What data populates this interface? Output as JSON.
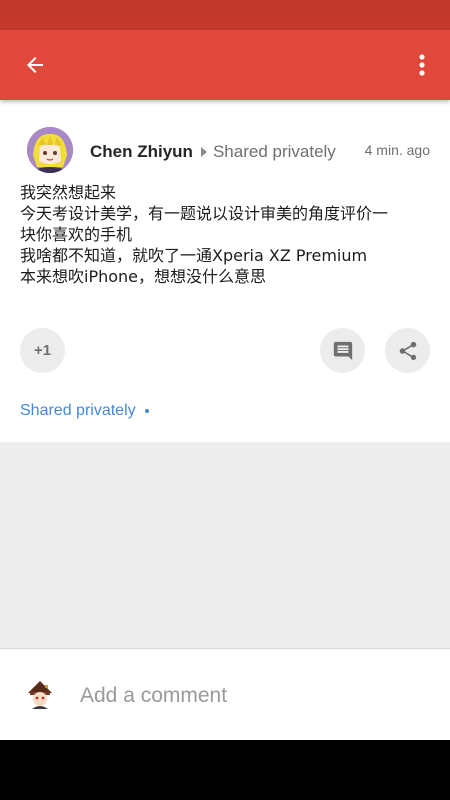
{
  "colors": {
    "status_bar": "#c33a2d",
    "app_bar": "#e0483c",
    "link": "#4688d8",
    "muted_text": "#6f6f6f",
    "button_bg": "#ececec"
  },
  "app_bar": {
    "back_icon": "arrow-back-icon",
    "menu_icon": "more-vert-icon"
  },
  "post": {
    "author": "Chen Zhiyun",
    "visibility": "Shared privately",
    "time": "4 min. ago",
    "body_lines": [
      "我突然想起来",
      "今天考设计美学，有一题说以设计审美的角度评价一",
      "块你喜欢的手机",
      "我啥都不知道，就吹了一通Xperia XZ Premium",
      "本来想吹iPhone，想想没什么意思"
    ],
    "plus_one_label": "+1",
    "comment_icon": "comment-icon",
    "share_icon": "share-icon"
  },
  "footer": {
    "shared_label": "Shared privately"
  },
  "comment_box": {
    "placeholder": "Add a comment"
  }
}
